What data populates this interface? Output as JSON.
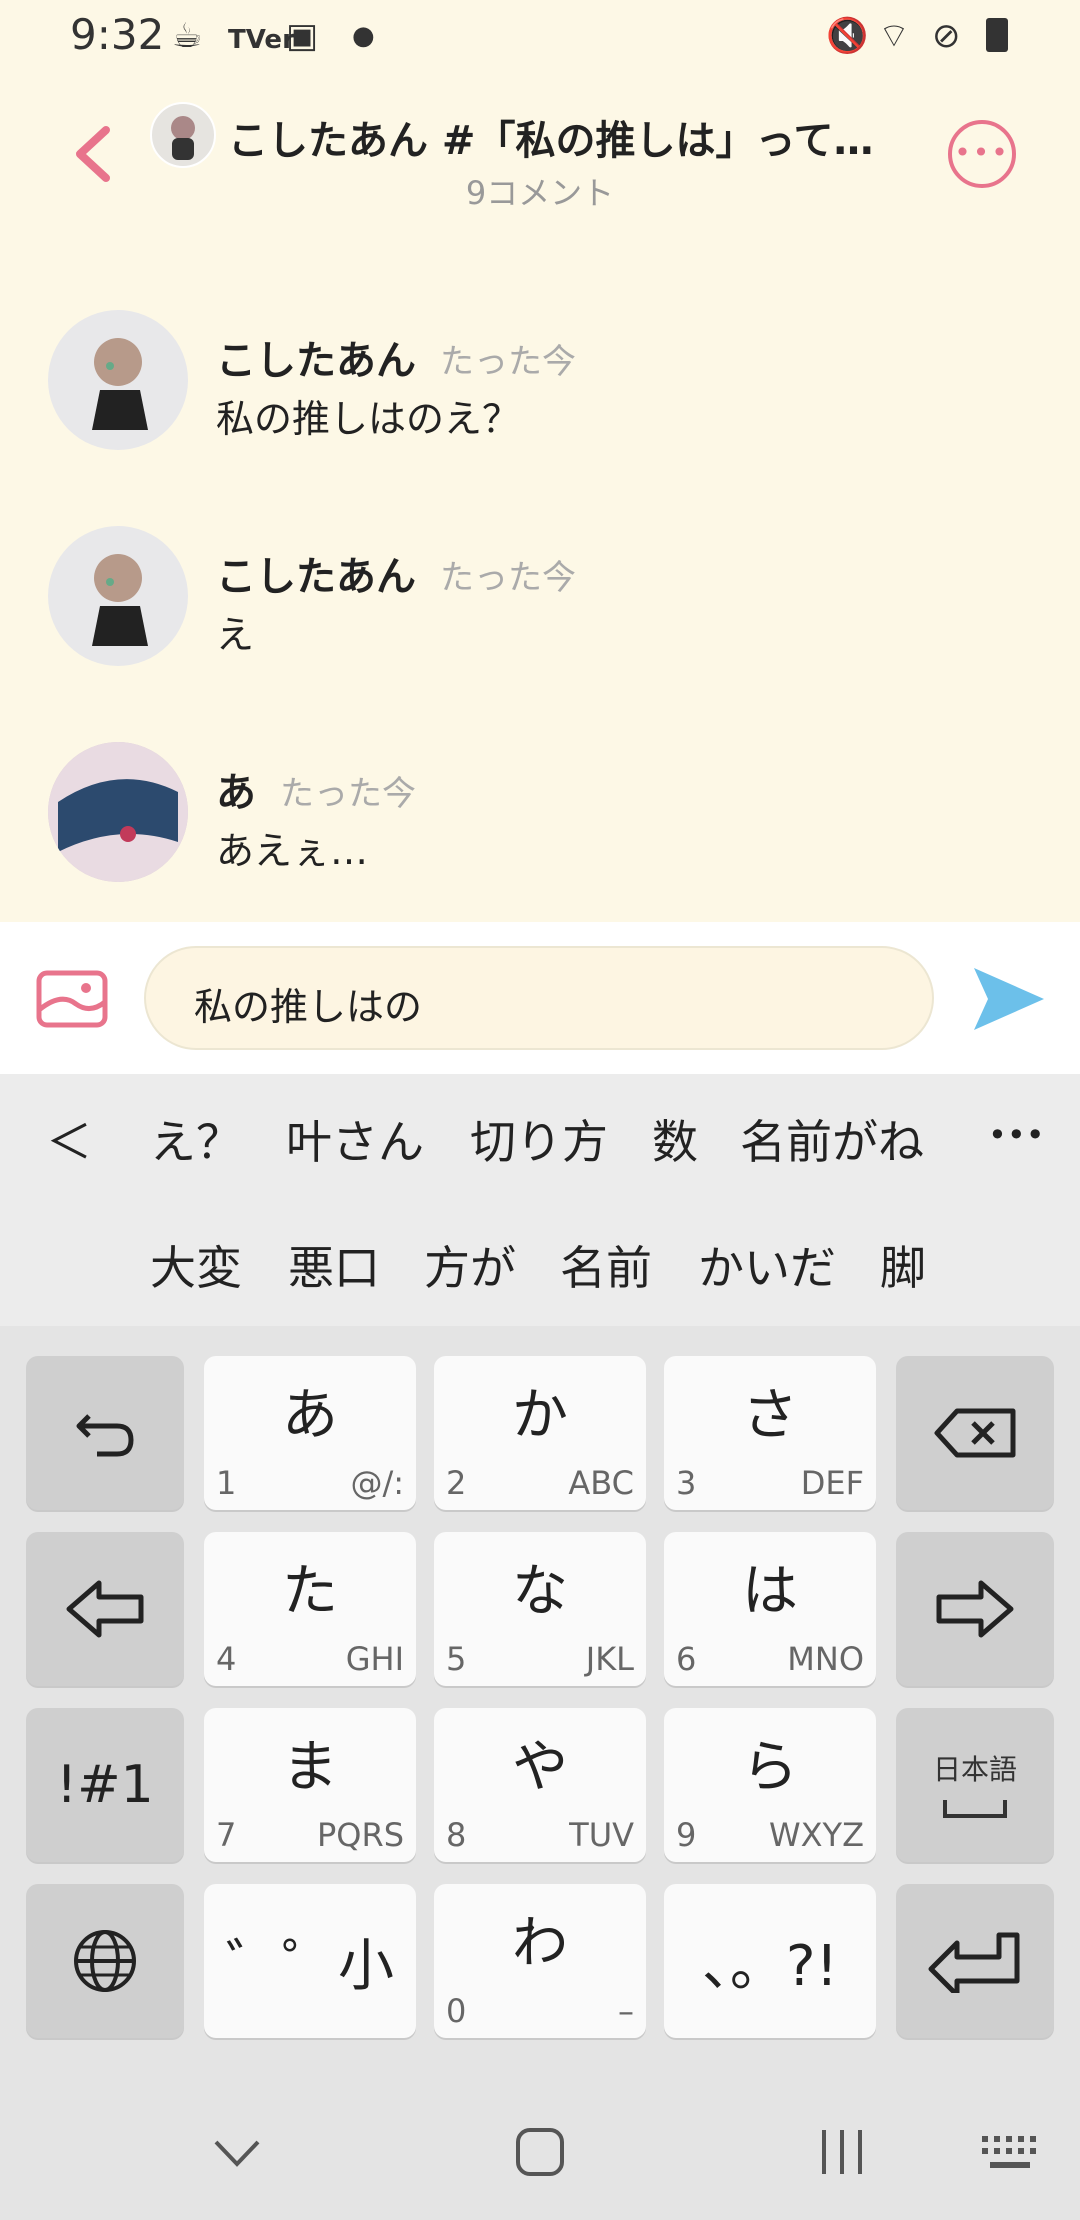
{
  "status_bar": {
    "time": "9:32",
    "tver": "TVer"
  },
  "header": {
    "title": "こしたあん #「私の推しは」って打…",
    "subtitle": "9コメント"
  },
  "comments": [
    {
      "name": "こしたあん",
      "time": "たった今",
      "text": "私の推しはのえ？"
    },
    {
      "name": "こしたあん",
      "time": "たった今",
      "text": "え"
    },
    {
      "name": "あ",
      "time": "たった今",
      "text": "あえぇ…"
    }
  ],
  "input": {
    "value": "私の推しはの"
  },
  "candidates": {
    "row1": [
      "え？",
      "叶さん",
      "切り方",
      "数",
      "名前がね"
    ],
    "row2": [
      "大変",
      "悪口",
      "方が",
      "名前",
      "かいだ",
      "脚"
    ],
    "more": "•••",
    "back": "＜"
  },
  "keyboard": {
    "keys": [
      {
        "main": "あ",
        "num": "1",
        "sub": "@/:"
      },
      {
        "main": "か",
        "num": "2",
        "sub": "ABC"
      },
      {
        "main": "さ",
        "num": "3",
        "sub": "DEF"
      },
      {
        "main": "た",
        "num": "4",
        "sub": "GHI"
      },
      {
        "main": "な",
        "num": "5",
        "sub": "JKL"
      },
      {
        "main": "は",
        "num": "6",
        "sub": "MNO"
      },
      {
        "main": "ま",
        "num": "7",
        "sub": "PQRS"
      },
      {
        "main": "や",
        "num": "8",
        "sub": "TUV"
      },
      {
        "main": "ら",
        "num": "9",
        "sub": "WXYZ"
      },
      {
        "main": "わ",
        "num": "0",
        "sub": "–"
      }
    ],
    "symbols": "!#1",
    "dakuten": "゛゜小",
    "punct": "、。?!",
    "lang": "日本語"
  },
  "colors": {
    "accent": "#e8748c",
    "send": "#6cc0ea",
    "background": "#fdf8e6"
  }
}
